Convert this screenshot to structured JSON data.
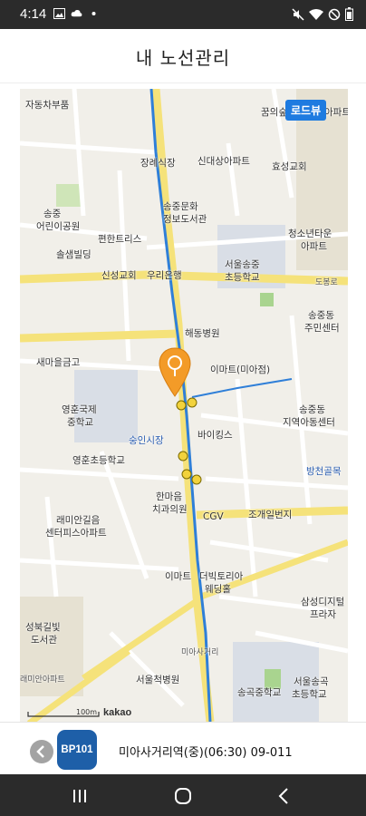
{
  "status_bar": {
    "time": "4:14",
    "left_icons": [
      "image-icon",
      "cloud-icon",
      "dot-icon"
    ],
    "right_icons": [
      "mute-icon",
      "wifi-icon",
      "no-disturb-icon",
      "battery-icon"
    ]
  },
  "header": {
    "title": "내 노선관리"
  },
  "map": {
    "roadview_label": "로드뷰",
    "scale_label": "100m",
    "provider": "kakao",
    "labels": {
      "l1": "자동차부품",
      "l2": "장례식장",
      "l3": "신대상아파트",
      "l4": "효성교회",
      "l5": "송중문화",
      "l6": "정보도서관",
      "l7": "송중",
      "l8": "어린이공원",
      "l9": "편한트리스",
      "l10": "솔샘빌딩",
      "l11": "신성교회",
      "l12": "우리은행",
      "l13": "서울송중",
      "l14": "초등학교",
      "l15": "청소년타운",
      "l16": "아파트",
      "l17": "송중동",
      "l18": "주민센터",
      "l19": "새마을금고",
      "l20": "해동병원",
      "l21": "이마트(미아점)",
      "l22": "영훈국제",
      "l23": "중학교",
      "l24": "숭인시장",
      "l25": "송중동",
      "l26": "지역아동센터",
      "l27": "영훈초등학교",
      "l28": "바이킹스",
      "l29": "한마음",
      "l30": "치과의원",
      "l31": "CGV",
      "l32": "래미안길음",
      "l33": "센터피스아파트",
      "l34": "이마트",
      "l35": "더빅토리아",
      "l36": "웨딩홀",
      "l37": "삼성디지털",
      "l38": "프라자",
      "l39": "성북길빛",
      "l40": "도서관",
      "l41": "래미안아파트",
      "l42": "서울척병원",
      "l43": "송곡중학교",
      "l44": "서울송곡",
      "l45": "초등학교",
      "l46": "방천골목",
      "l47": "미아사거리",
      "l48": "꿈의숲",
      "l49": "아파트",
      "l50": "도봉로",
      "l51": "조개일번지"
    }
  },
  "bottom": {
    "route_badge": "BP101",
    "route_description": "미아사거리역(중)(06:30) 09-011"
  },
  "colors": {
    "route_line": "#2f7fd8",
    "road_major": "#f7e78a",
    "pin": "#f39b28",
    "badge": "#1e5fa8"
  }
}
